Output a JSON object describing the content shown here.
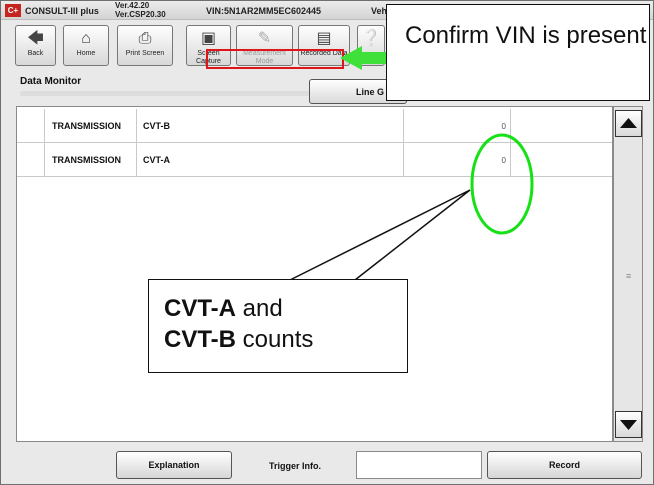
{
  "titlebar": {
    "logo": "C+",
    "app_name": "CONSULT-III plus",
    "version": "Ver.42.20",
    "version2": "Ver.CSP20.30",
    "vin": "VIN:5N1AR2MM5EC602445",
    "vehicle_fragment": "Veh"
  },
  "toolbar": {
    "back": "Back",
    "home": "Home",
    "print_screen": "Print Screen",
    "screen_capture": "Screen Capture",
    "measurement_mode": "Measurement Mode",
    "recorded_data": "Recorded Data"
  },
  "section": {
    "title": "Data Monitor",
    "line_button": "Line G"
  },
  "table": {
    "rows": [
      {
        "system": "TRANSMISSION",
        "item": "CVT-B",
        "value": "0"
      },
      {
        "system": "TRANSMISSION",
        "item": "CVT-A",
        "value": "0"
      }
    ]
  },
  "bottom": {
    "explanation": "Explanation",
    "trigger_info": "Trigger Info.",
    "record": "Record"
  },
  "callouts": {
    "top": "Confirm VIN is present",
    "bottom_bold_1": "CVT-A",
    "bottom_text_1": " and",
    "bottom_bold_2": "CVT-B",
    "bottom_text_2": " counts"
  },
  "colors": {
    "highlight_red": "#e0151a",
    "arrow_green": "#3fe03a",
    "ellipse_green": "#16e016"
  }
}
